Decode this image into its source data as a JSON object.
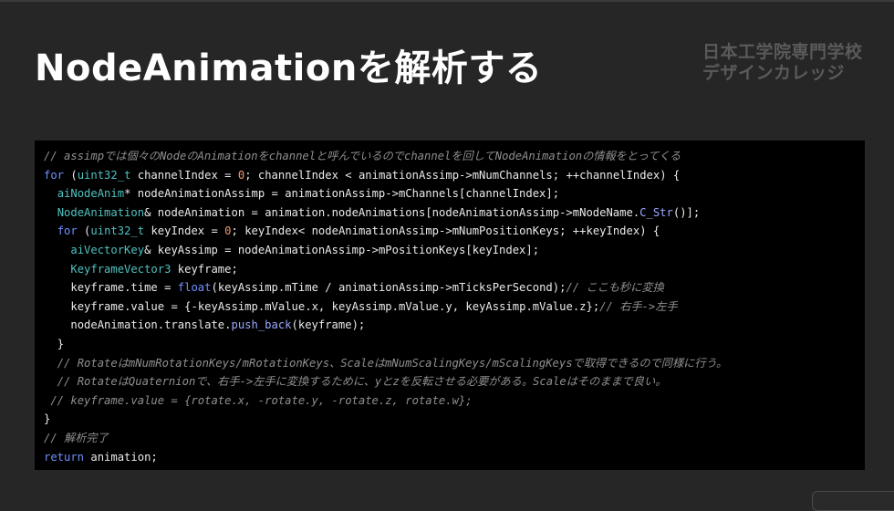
{
  "slide": {
    "title": "NodeAnimationを解析する",
    "logo_line1": "日本工学院専門学校",
    "logo_line2": "デザインカレッジ"
  },
  "colors": {
    "background": "#262626",
    "code_background": "#000000",
    "comment": "#8f8f8f",
    "keyword": "#6f8fff",
    "type": "#4fc1c0",
    "number": "#f29b6a",
    "function": "#9aa7ff"
  },
  "code": {
    "language": "cpp",
    "lines": [
      "// assimpでは個々のNodeのAnimationをchannelと呼んでいるのでchannelを回してNodeAnimationの情報をとってくる",
      "for (uint32_t channelIndex = 0; channelIndex < animationAssimp->mNumChannels; ++channelIndex) {",
      "  aiNodeAnim* nodeAnimationAssimp = animationAssimp->mChannels[channelIndex];",
      "  NodeAnimation& nodeAnimation = animation.nodeAnimations[nodeAnimationAssimp->mNodeName.C_Str()];",
      "  for (uint32_t keyIndex = 0; keyIndex< nodeAnimationAssimp->mNumPositionKeys; ++keyIndex) {",
      "    aiVectorKey& keyAssimp = nodeAnimationAssimp->mPositionKeys[keyIndex];",
      "    KeyframeVector3 keyframe;",
      "    keyframe.time = float(keyAssimp.mTime / animationAssimp->mTicksPerSecond);// ここも秒に変換",
      "    keyframe.value = {-keyAssimp.mValue.x, keyAssimp.mValue.y, keyAssimp.mValue.z};// 右手->左手",
      "    nodeAnimation.translate.push_back(keyframe);",
      "  }",
      "  // RotateはmNumRotationKeys/mRotationKeys、ScaleはmNumScalingKeys/mScalingKeysで取得できるので同様に行う。",
      "  // RotateはQuaternionで、右手->左手に変換するために、yとzを反転させる必要がある。Scaleはそのままで良い。",
      " // keyframe.value = {rotate.x, -rotate.y, -rotate.z, rotate.w};",
      "}",
      "// 解析完了",
      "return animation;"
    ]
  }
}
